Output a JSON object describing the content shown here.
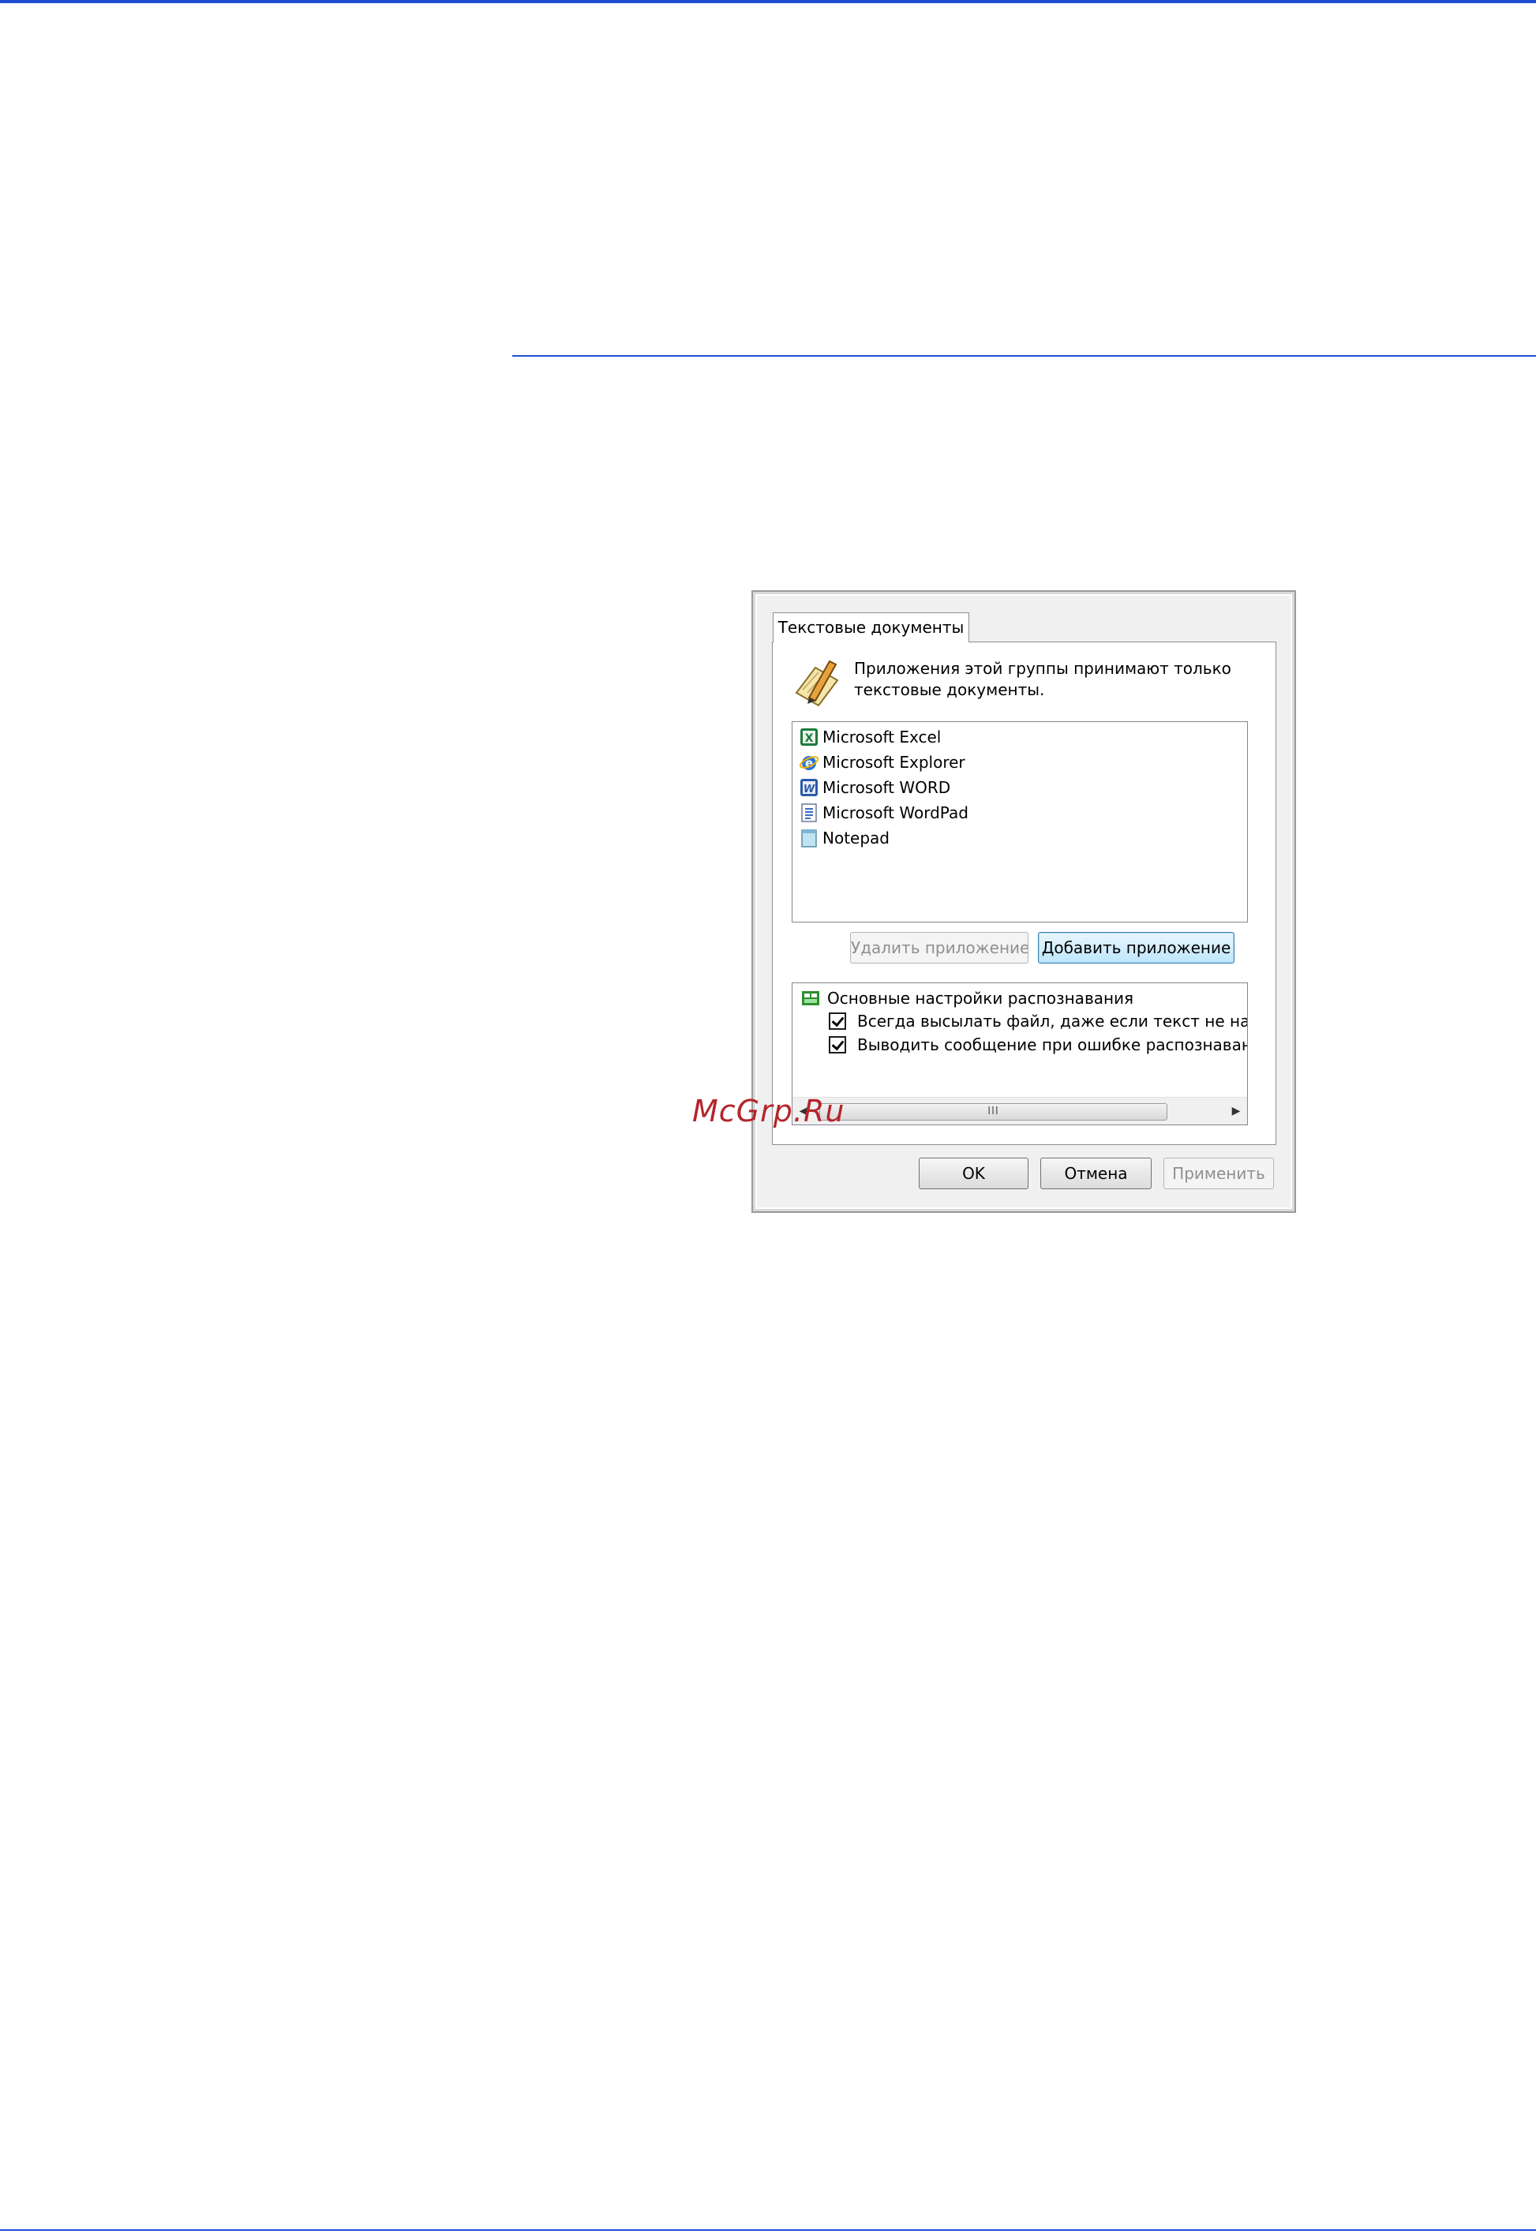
{
  "dialog": {
    "tab_label": "Текстовые документы",
    "header_text": "Приложения этой группы принимают только текстовые документы.",
    "applications": [
      {
        "label": "Microsoft Excel",
        "icon": "excel-icon"
      },
      {
        "label": "Microsoft Explorer",
        "icon": "internet-explorer-icon"
      },
      {
        "label": "Microsoft WORD",
        "icon": "word-icon"
      },
      {
        "label": "Microsoft WordPad",
        "icon": "wordpad-icon"
      },
      {
        "label": "Notepad",
        "icon": "notepad-icon"
      }
    ],
    "remove_app_label": "Удалить приложение",
    "add_app_label": "Добавить приложение",
    "ocr_settings": {
      "root_label": "Основные настройки распознавания",
      "options": [
        {
          "label": "Всегда высылать файл, даже если текст не найд",
          "checked": true
        },
        {
          "label": "Выводить сообщение при ошибке распознавания",
          "checked": true
        }
      ],
      "scroll_thumb_grip": "III"
    },
    "ok_label": "OK",
    "cancel_label": "Отмена",
    "apply_label": "Применить"
  },
  "watermark": "McGrp.Ru",
  "colors": {
    "rule_blue": "#1f4fd0",
    "watermark_red": "#b4252b",
    "dialog_bg": "#f0f0f0"
  }
}
